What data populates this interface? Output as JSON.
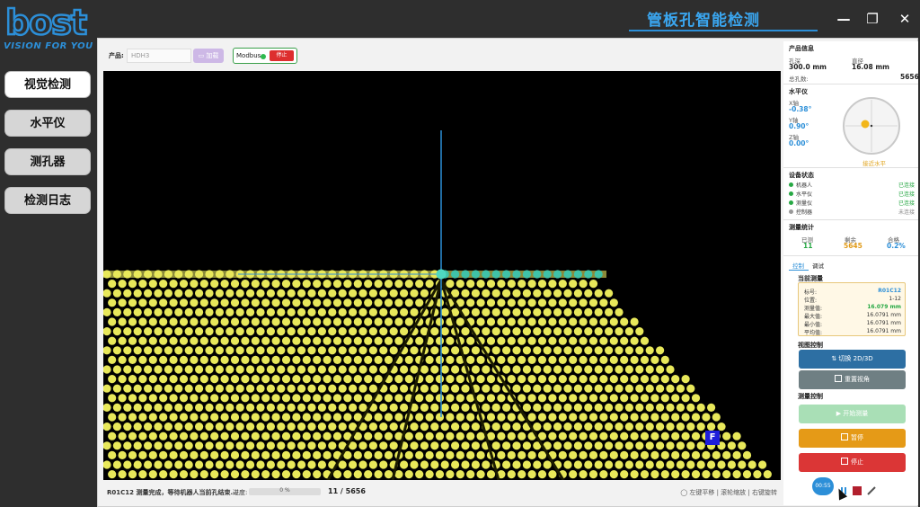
{
  "logo": {
    "brand": "bost",
    "tagline": "VISION FOR YOU"
  },
  "title": "管板孔智能检测",
  "window_controls": {
    "minimize": "—",
    "restore": "❐",
    "close": "✕"
  },
  "nav": [
    {
      "label": "视觉检测",
      "active": true
    },
    {
      "label": "水平仪",
      "active": false
    },
    {
      "label": "测孔器",
      "active": false
    },
    {
      "label": "检测日志",
      "active": false
    }
  ],
  "toolbar": {
    "product_label": "产品:",
    "product_value": "HDH3",
    "load_button": "加载",
    "modbus_label": "Modbus",
    "modbus_stop": "停止"
  },
  "viewport": {
    "f_badge": "F"
  },
  "statusbar": {
    "message": "R01C12 测量完成，等待机器人当前孔结束...",
    "progress_label": "进度:",
    "progress_percent": 0,
    "progress_text": "0 %",
    "count": "11 / 5656",
    "hint": "左键平移 | 滚轮缩放 | 右键旋转"
  },
  "product_info": {
    "title": "产品信息",
    "depth_label": "孔深",
    "depth_value": "300.0 mm",
    "diameter_label": "直径",
    "diameter_value": "16.08 mm",
    "total_label": "总孔数:",
    "total_value": "5656"
  },
  "level": {
    "title": "水平仪",
    "x_label": "X轴",
    "x_value": "-0.38°",
    "y_label": "Y轴",
    "y_value": "0.90°",
    "z_label": "Z轴",
    "z_value": "0.00°",
    "status": "接近水平"
  },
  "device_status": {
    "title": "设备状态",
    "items": [
      {
        "name": "机器人",
        "status": "已连接",
        "color": "#27a844"
      },
      {
        "name": "水平仪",
        "status": "已连接",
        "color": "#27a844"
      },
      {
        "name": "测量仪",
        "status": "已连接",
        "color": "#27a844"
      },
      {
        "name": "控制器",
        "status": "未连接",
        "color": "#999999"
      }
    ]
  },
  "stats": {
    "title": "测量统计",
    "done_label": "已测",
    "done_value": "11",
    "remain_label": "剩余",
    "remain_value": "5645",
    "pass_label": "合格",
    "pass_value": "0.2%"
  },
  "tabs": [
    {
      "label": "控制",
      "active": true
    },
    {
      "label": "调试",
      "active": false
    }
  ],
  "current": {
    "title": "当前测量",
    "rows": [
      {
        "label": "标号:",
        "value": "R01C12"
      },
      {
        "label": "位置:",
        "value": "1-12"
      },
      {
        "label": "测量值:",
        "value": "16.079 mm"
      },
      {
        "label": "最大值:",
        "value": "16.0791 mm"
      },
      {
        "label": "最小值:",
        "value": "16.0791 mm"
      },
      {
        "label": "平均值:",
        "value": "16.0791 mm"
      }
    ]
  },
  "view_control": {
    "title": "视图控制",
    "switch_button": "切换 2D/3D",
    "reset_button": "重置视角"
  },
  "measure_control": {
    "title": "测量控制",
    "start_button": "开始测量",
    "pause_button": "暂停",
    "stop_button": "停止"
  },
  "timer": "00:55",
  "colors": {
    "accent": "#2c8fd8",
    "dot": "#e8e85a",
    "active_dot": "#3fc2a8",
    "start": "#a9dfb6",
    "pause": "#e59a17",
    "stop": "#db3636",
    "switch": "#2d6fa3",
    "reset": "#6f7f83"
  }
}
